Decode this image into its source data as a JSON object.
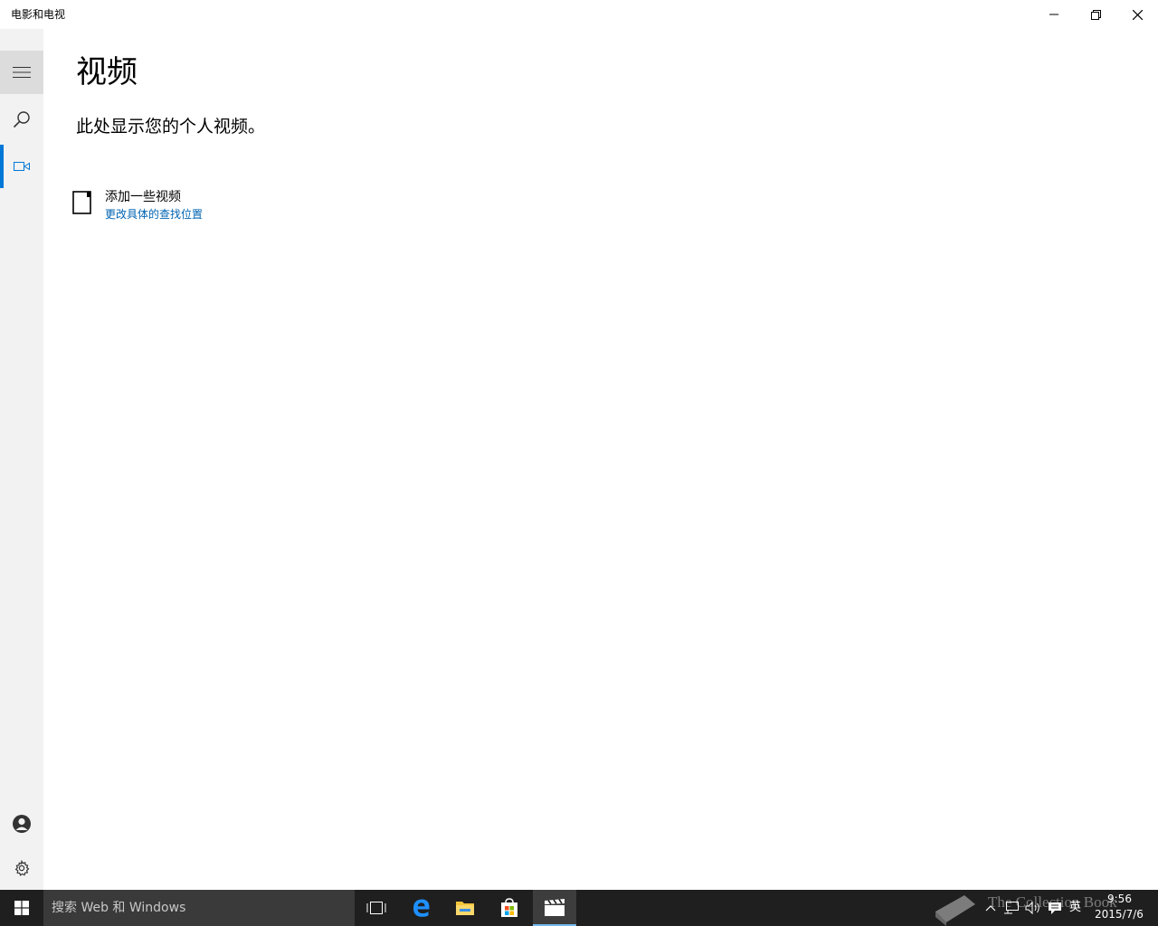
{
  "window": {
    "title": "电影和电视",
    "minimize_icon": "minimize-icon",
    "maximize_icon": "restore-icon",
    "close_icon": "close-icon"
  },
  "nav": {
    "items": [
      {
        "icon": "hamburger-menu-icon"
      },
      {
        "icon": "search-icon"
      },
      {
        "icon": "video-icon",
        "active": true
      },
      {
        "icon": "account-icon"
      },
      {
        "icon": "settings-gear-icon"
      }
    ],
    "accent_color": "#0078d7"
  },
  "main": {
    "title": "视频",
    "subtitle": "此处显示您的个人视频。",
    "add_videos": {
      "label": "添加一些视频",
      "link": "更改具体的查找位置",
      "link_color": "#0063b1"
    }
  },
  "taskbar": {
    "search_placeholder": "搜索 Web 和 Windows",
    "apps": [
      "task-view-icon",
      "edge-icon",
      "file-explorer-icon",
      "store-icon",
      "movies-tv-icon"
    ],
    "tray": {
      "ime": "英",
      "time": "9:56",
      "date": "2015/7/6"
    },
    "watermark": "The Collection Book"
  }
}
